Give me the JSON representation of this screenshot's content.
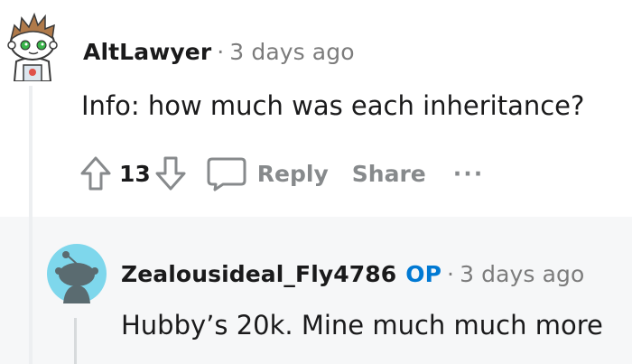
{
  "comments": [
    {
      "username": "AltLawyer",
      "separator": "·",
      "time": "3 days ago",
      "body": "Info: how much was each inheritance?",
      "votes": "13",
      "actions": {
        "reply": "Reply",
        "share": "Share",
        "more": "···"
      },
      "avatar": "snoo-avatar-brown-hair-green-eyes"
    },
    {
      "username": "Zealousideal_Fly4786",
      "badge": "OP",
      "separator": "·",
      "time": "3 days ago",
      "body": "Hubby’s 20k. Mine much much more",
      "avatar": "default-snoo-avatar"
    }
  ],
  "colors": {
    "op_badge": "#0079d3",
    "muted": "#7c7c7c",
    "reply_bg": "#f6f7f8",
    "avatar2_bg": "#7ed7ec"
  }
}
